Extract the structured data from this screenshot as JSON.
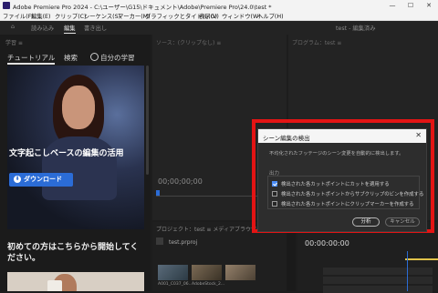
{
  "window": {
    "title": "Adobe Premiere Pro 2024 - C:\\ユーザー\\G15\\ドキュメント\\Adobe\\Premiere Pro\\24.0\\test *",
    "minimize": "—",
    "maximize": "☐",
    "close": "✕"
  },
  "menu": [
    "ファイル(F)",
    "編集(E)",
    "クリップ(C)",
    "シーケンス(S)",
    "マーカー(M)",
    "グラフィックとタイトル(G)",
    "表示(V)",
    "ウィンドウ(W)",
    "ヘルプ(H)"
  ],
  "workspaces": {
    "items": [
      "読み込み",
      "編集",
      "書き出し"
    ],
    "active": "編集",
    "right": "test - 編集済み"
  },
  "learn": {
    "panel_header": "学習 ≡",
    "tabs": [
      "チュートリアル",
      "検索"
    ],
    "my_learning": "自分の学習",
    "hero_title": "文字起こしベースの編集の活用",
    "download_label": "ダウンロード",
    "download_icon": "⬇",
    "second_title": "初めての方はこちらから開始してください。"
  },
  "source_panel": {
    "header": "ソース：(クリップなし) ≡",
    "timecode": "00;00;00;00"
  },
  "program_panel": {
    "header": "プログラム：test ≡"
  },
  "project_panel": {
    "tabs": "プロジェクト：test ≡   メディアブラウザー",
    "project_file": "test.prproj",
    "clips": [
      "A001_C037_06...",
      "AdobeStock_2...",
      ""
    ]
  },
  "timeline": {
    "timecode": "00:00:00:00"
  },
  "dialog": {
    "title": "シーン編集の検出",
    "close": "✕",
    "description": "不均化されたフッテージのシーン変更を自動的に検出します。",
    "output_header": "出力",
    "options": [
      {
        "label": "検出された各カットポイントにカットを適用する",
        "checked": true
      },
      {
        "label": "検出された各カットポイントからサブクリップのビンを作成する",
        "checked": false
      },
      {
        "label": "検出された各カットポイントにクリップマーカーを作成する",
        "checked": false
      }
    ],
    "analyze_label": "分析",
    "cancel_label": "キャンセル"
  },
  "colors": {
    "highlight_frame": "#e31414",
    "accent_blue": "#2b6cd6"
  }
}
